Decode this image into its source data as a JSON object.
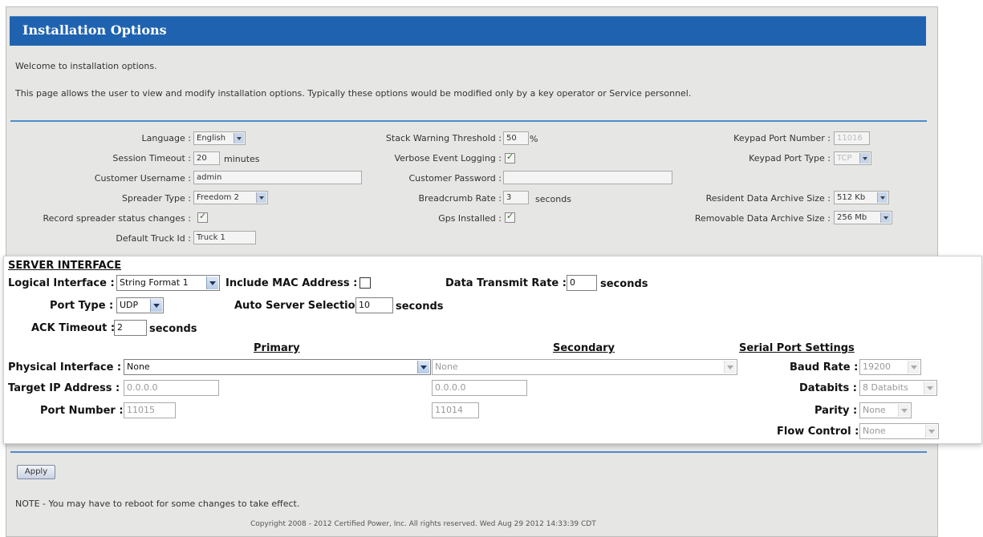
{
  "header": {
    "title": "Installation Options"
  },
  "intro": {
    "welcome": "Welcome to installation options.",
    "description": "This page allows the user to view and modify installation options. Typically these options would be modified only by a key operator or Service personnel."
  },
  "general": {
    "language": {
      "label": "Language :",
      "value": "English"
    },
    "session_timeout": {
      "label": "Session Timeout :",
      "value": "20",
      "unit": "minutes"
    },
    "customer_username": {
      "label": "Customer Username :",
      "value": "admin"
    },
    "spreader_type": {
      "label": "Spreader Type :",
      "value": "Freedom 2"
    },
    "record_spreader": {
      "label": "Record spreader status changes :",
      "checked": true
    },
    "default_truck_id": {
      "label": "Default Truck Id :",
      "value": "Truck 1"
    },
    "stack_warning": {
      "label": "Stack Warning Threshold :",
      "value": "50",
      "unit": "%"
    },
    "verbose_logging": {
      "label": "Verbose Event Logging :",
      "checked": true
    },
    "customer_password": {
      "label": "Customer Password :",
      "value": ""
    },
    "breadcrumb_rate": {
      "label": "Breadcrumb Rate :",
      "value": "3",
      "unit": "seconds"
    },
    "gps_installed": {
      "label": "Gps Installed :",
      "checked": true
    },
    "keypad_port_number": {
      "label": "Keypad Port Number :",
      "value": "11016"
    },
    "keypad_port_type": {
      "label": "Keypad Port Type :",
      "value": "TCP"
    },
    "resident_archive": {
      "label": "Resident Data Archive Size :",
      "value": "512 Kb"
    },
    "removable_archive": {
      "label": "Removable Data Archive Size :",
      "value": "256 Mb"
    }
  },
  "server": {
    "title": "SERVER INTERFACE",
    "logical_interface": {
      "label": "Logical Interface :",
      "value": "String Format 1"
    },
    "include_mac": {
      "label": "Include MAC Address :",
      "checked": false
    },
    "data_transmit_rate": {
      "label": "Data Transmit Rate :",
      "value": "0",
      "unit": "seconds"
    },
    "port_type": {
      "label": "Port Type :",
      "value": "UDP"
    },
    "auto_server_selection": {
      "label": "Auto Server Selection :",
      "value": "10",
      "unit": "seconds"
    },
    "ack_timeout": {
      "label": "ACK Timeout :",
      "value": "2",
      "unit": "seconds"
    },
    "primary_heading": "Primary",
    "secondary_heading": "Secondary",
    "serial_heading": "Serial Port Settings",
    "physical_interface": {
      "label": "Physical Interface :",
      "primary": "None",
      "secondary": "None"
    },
    "target_ip": {
      "label": "Target IP Address :",
      "primary": "0.0.0.0",
      "secondary": "0.0.0.0"
    },
    "port_number": {
      "label": "Port Number :",
      "primary": "11015",
      "secondary": "11014"
    },
    "baud_rate": {
      "label": "Baud Rate :",
      "value": "19200"
    },
    "databits": {
      "label": "Databits :",
      "value": "8 Databits"
    },
    "parity": {
      "label": "Parity :",
      "value": "None"
    },
    "flow_control": {
      "label": "Flow Control :",
      "value": "None"
    }
  },
  "actions": {
    "apply": "Apply"
  },
  "note": "NOTE - You may have to reboot for some changes to take effect.",
  "footer": "Copyright 2008 - 2012 Certified Power, Inc. All rights reserved. Wed Aug 29 2012 14:33:39 CDT",
  "colors": {
    "header": "#1f63b0",
    "divider": "#4d8ccc"
  }
}
